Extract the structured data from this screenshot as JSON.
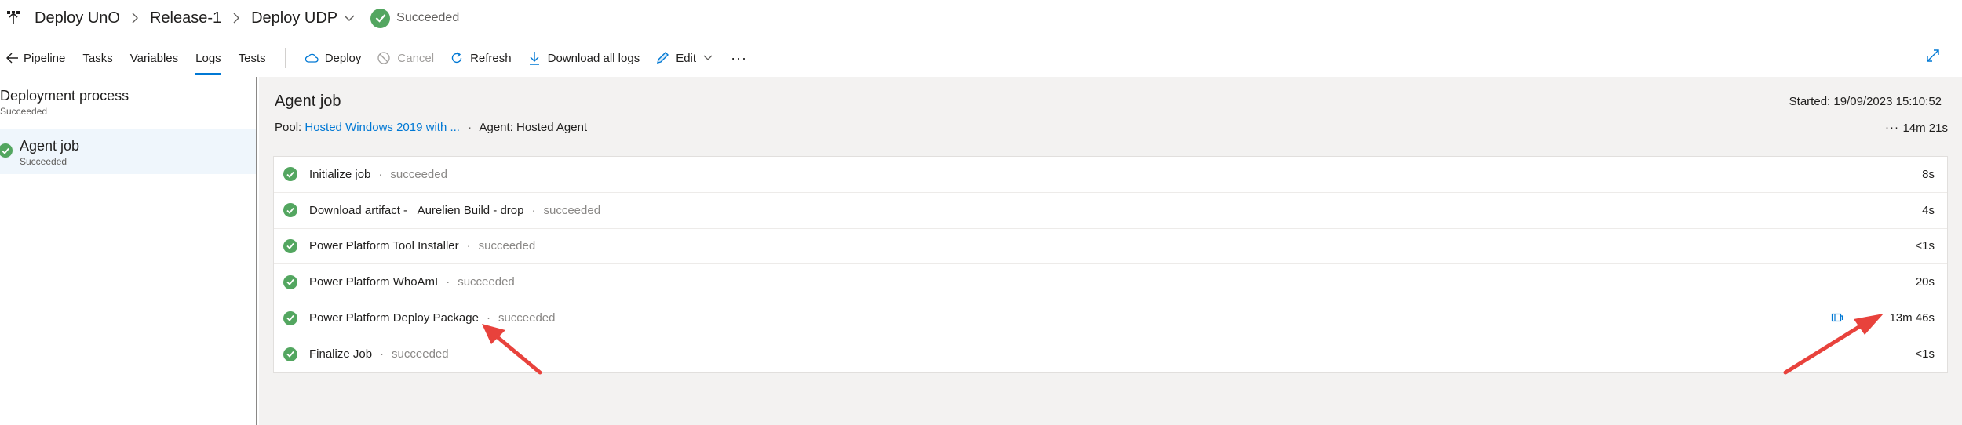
{
  "header": {
    "crumbs": [
      "Deploy UnO",
      "Release-1",
      "Deploy UDP"
    ],
    "status": "Succeeded"
  },
  "toolbar": {
    "back_label": "Pipeline",
    "tabs": [
      {
        "label": "Tasks",
        "active": false
      },
      {
        "label": "Variables",
        "active": false
      },
      {
        "label": "Logs",
        "active": true
      },
      {
        "label": "Tests",
        "active": false
      }
    ],
    "actions": {
      "deploy": "Deploy",
      "cancel": "Cancel",
      "refresh": "Refresh",
      "download": "Download all logs",
      "edit": "Edit",
      "more": "···"
    }
  },
  "left_pane": {
    "process": {
      "title": "Deployment process",
      "status": "Succeeded"
    },
    "agent": {
      "title": "Agent job",
      "status": "Succeeded"
    }
  },
  "job": {
    "title": "Agent job",
    "started": "Started: 19/09/2023 15:10:52",
    "pool_label": "Pool:",
    "pool_value": "Hosted Windows 2019 with ...",
    "agent": "Agent: Hosted Agent",
    "more": "···",
    "duration": "14m 21s",
    "steps": [
      {
        "name": "Initialize job",
        "status": "succeeded",
        "duration": "8s"
      },
      {
        "name": "Download artifact - _Aurelien Build - drop",
        "status": "succeeded",
        "duration": "4s"
      },
      {
        "name": "Power Platform Tool Installer",
        "status": "succeeded",
        "duration": "<1s"
      },
      {
        "name": "Power Platform WhoAmI",
        "status": "succeeded",
        "duration": "20s"
      },
      {
        "name": "Power Platform Deploy Package",
        "status": "succeeded",
        "duration": "13m 46s"
      },
      {
        "name": "Finalize Job",
        "status": "succeeded",
        "duration": "<1s"
      }
    ]
  },
  "colors": {
    "success": "#53a660",
    "accent": "#0078d4",
    "annotation": "#e8423c"
  }
}
